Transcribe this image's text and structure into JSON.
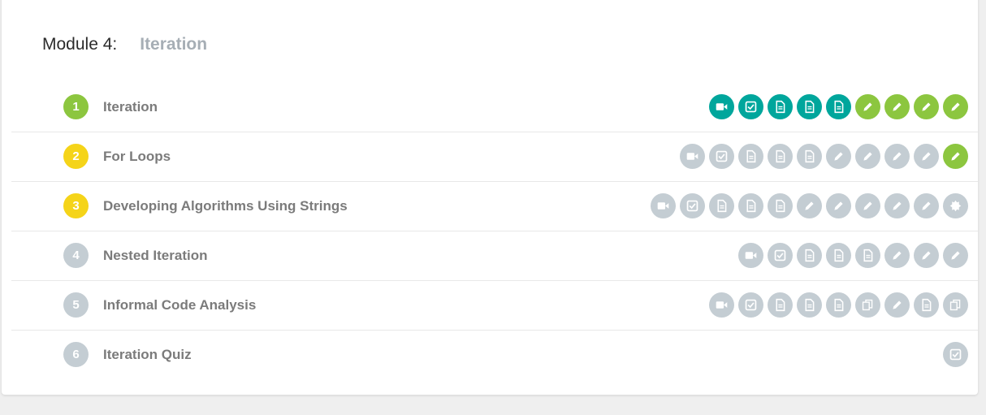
{
  "module": {
    "label": "Module 4:",
    "name": "Iteration"
  },
  "colors": {
    "teal": "#00a69c",
    "green": "#8cc63f",
    "yellow": "#f5d419",
    "gray": "#c4cdd3"
  },
  "lessons": [
    {
      "number": "1",
      "title": "Iteration",
      "status": "green",
      "activities": [
        {
          "type": "video",
          "state": "teal"
        },
        {
          "type": "check",
          "state": "teal"
        },
        {
          "type": "doc",
          "state": "teal"
        },
        {
          "type": "doc",
          "state": "teal"
        },
        {
          "type": "doc",
          "state": "teal"
        },
        {
          "type": "pencil",
          "state": "green"
        },
        {
          "type": "pencil",
          "state": "green"
        },
        {
          "type": "pencil",
          "state": "green"
        },
        {
          "type": "pencil",
          "state": "green"
        }
      ]
    },
    {
      "number": "2",
      "title": "For Loops",
      "status": "yellow",
      "activities": [
        {
          "type": "video",
          "state": "gray"
        },
        {
          "type": "check",
          "state": "gray"
        },
        {
          "type": "doc",
          "state": "gray"
        },
        {
          "type": "doc",
          "state": "gray"
        },
        {
          "type": "doc",
          "state": "gray"
        },
        {
          "type": "pencil",
          "state": "gray"
        },
        {
          "type": "pencil",
          "state": "gray"
        },
        {
          "type": "pencil",
          "state": "gray"
        },
        {
          "type": "pencil",
          "state": "gray"
        },
        {
          "type": "pencil",
          "state": "green"
        }
      ]
    },
    {
      "number": "3",
      "title": "Developing Algorithms Using Strings",
      "status": "yellow",
      "activities": [
        {
          "type": "video",
          "state": "gray"
        },
        {
          "type": "check",
          "state": "gray"
        },
        {
          "type": "doc",
          "state": "gray"
        },
        {
          "type": "doc",
          "state": "gray"
        },
        {
          "type": "doc",
          "state": "gray"
        },
        {
          "type": "pencil",
          "state": "gray"
        },
        {
          "type": "pencil",
          "state": "gray"
        },
        {
          "type": "pencil",
          "state": "gray"
        },
        {
          "type": "pencil",
          "state": "gray"
        },
        {
          "type": "pencil",
          "state": "gray"
        },
        {
          "type": "badge",
          "state": "gray"
        }
      ]
    },
    {
      "number": "4",
      "title": "Nested Iteration",
      "status": "gray",
      "activities": [
        {
          "type": "video",
          "state": "gray"
        },
        {
          "type": "check",
          "state": "gray"
        },
        {
          "type": "doc",
          "state": "gray"
        },
        {
          "type": "doc",
          "state": "gray"
        },
        {
          "type": "doc",
          "state": "gray"
        },
        {
          "type": "pencil",
          "state": "gray"
        },
        {
          "type": "pencil",
          "state": "gray"
        },
        {
          "type": "pencil",
          "state": "gray"
        }
      ]
    },
    {
      "number": "5",
      "title": "Informal Code Analysis",
      "status": "gray",
      "activities": [
        {
          "type": "video",
          "state": "gray"
        },
        {
          "type": "check",
          "state": "gray"
        },
        {
          "type": "doc",
          "state": "gray"
        },
        {
          "type": "doc",
          "state": "gray"
        },
        {
          "type": "doc",
          "state": "gray"
        },
        {
          "type": "copy",
          "state": "gray"
        },
        {
          "type": "pencil",
          "state": "gray"
        },
        {
          "type": "doc",
          "state": "gray"
        },
        {
          "type": "copy",
          "state": "gray"
        }
      ]
    },
    {
      "number": "6",
      "title": "Iteration Quiz",
      "status": "gray",
      "activities": [
        {
          "type": "check",
          "state": "gray"
        }
      ]
    }
  ]
}
